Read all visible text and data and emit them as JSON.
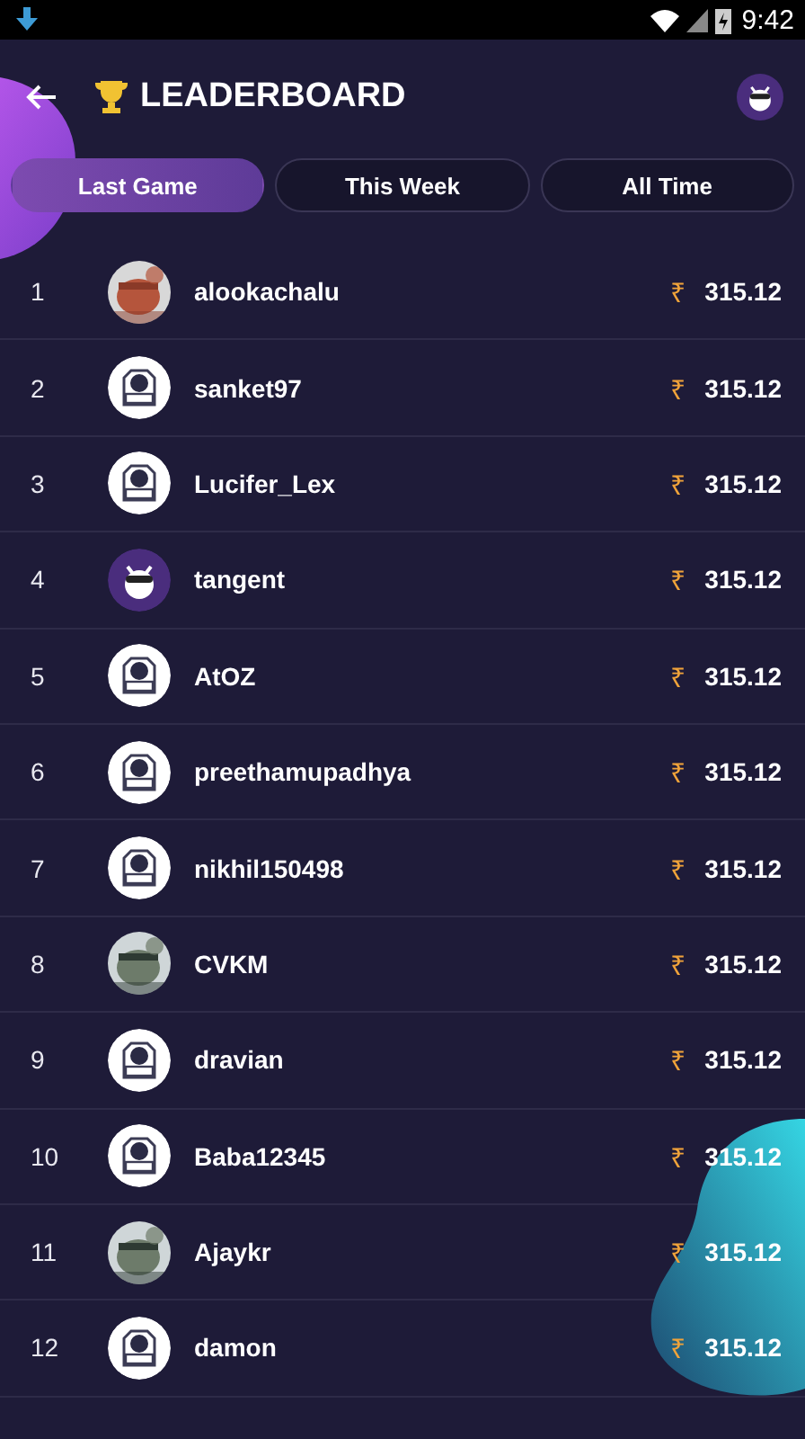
{
  "status_bar": {
    "time": "9:42"
  },
  "header": {
    "title": "LEADERBOARD"
  },
  "tabs": [
    {
      "label": "Last Game",
      "selected": true
    },
    {
      "label": "This Week",
      "selected": false
    },
    {
      "label": "All Time",
      "selected": false
    }
  ],
  "rows": [
    {
      "rank": "1",
      "name": "alookachalu",
      "currency": "₹",
      "amount": "315.12"
    },
    {
      "rank": "2",
      "name": "sanket97",
      "kind": "robot",
      "currency": "₹",
      "amount": "315.12"
    },
    {
      "rank": "3",
      "name": "Lucifer_Lex",
      "kind": "robot",
      "currency": "₹",
      "amount": "315.12"
    },
    {
      "rank": "4",
      "name": "tangent",
      "kind": "mascot",
      "currency": "₹",
      "amount": "315.12"
    },
    {
      "rank": "5",
      "name": "AtOZ",
      "kind": "robot",
      "currency": "₹",
      "amount": "315.12"
    },
    {
      "rank": "6",
      "name": "preethamupadhya",
      "kind": "robot",
      "currency": "₹",
      "amount": "315.12"
    },
    {
      "rank": "7",
      "name": "nikhil150498",
      "kind": "robot",
      "currency": "₹",
      "amount": "315.12"
    },
    {
      "rank": "8",
      "name": "CVKM",
      "currency": "₹",
      "amount": "315.12"
    },
    {
      "rank": "9",
      "name": "dravian",
      "kind": "robot",
      "currency": "₹",
      "amount": "315.12"
    },
    {
      "rank": "10",
      "name": "Baba12345",
      "kind": "robot",
      "currency": "₹",
      "amount": "315.12"
    },
    {
      "rank": "11",
      "name": "Ajaykr",
      "currency": "₹",
      "amount": "315.12"
    },
    {
      "rank": "12",
      "name": "damon",
      "kind": "robot",
      "currency": "₹",
      "amount": "315.12"
    }
  ]
}
